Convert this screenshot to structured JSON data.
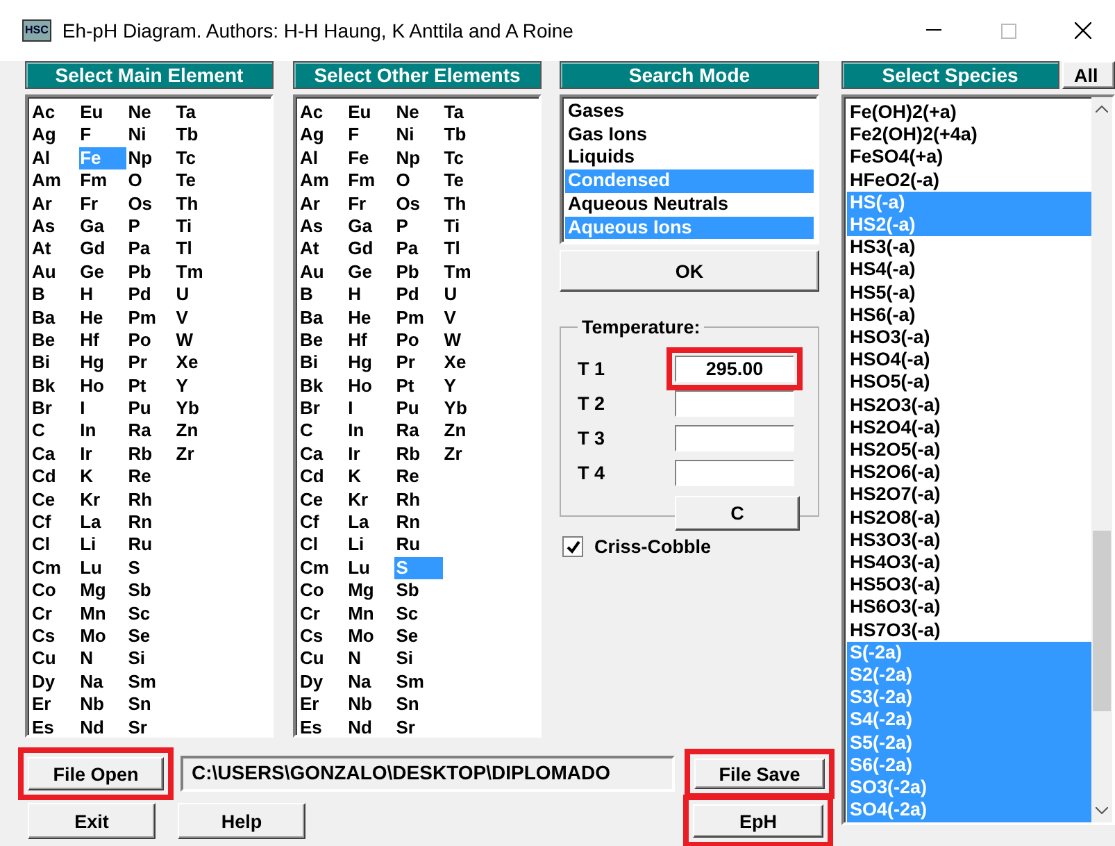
{
  "window": {
    "icon_text": "HSC",
    "title": "Eh-pH Diagram. Authors: H-H Haung, K Anttila and A Roine"
  },
  "main_element": {
    "header": "Select Main Element",
    "items": [
      {
        "label": "Ac",
        "selected": false
      },
      {
        "label": "Ag",
        "selected": false
      },
      {
        "label": "Al",
        "selected": false
      },
      {
        "label": "Am",
        "selected": false
      },
      {
        "label": "Ar",
        "selected": false
      },
      {
        "label": "As",
        "selected": false
      },
      {
        "label": "At",
        "selected": false
      },
      {
        "label": "Au",
        "selected": false
      },
      {
        "label": "B",
        "selected": false
      },
      {
        "label": "Ba",
        "selected": false
      },
      {
        "label": "Be",
        "selected": false
      },
      {
        "label": "Bi",
        "selected": false
      },
      {
        "label": "Bk",
        "selected": false
      },
      {
        "label": "Br",
        "selected": false
      },
      {
        "label": "C",
        "selected": false
      },
      {
        "label": "Ca",
        "selected": false
      },
      {
        "label": "Cd",
        "selected": false
      },
      {
        "label": "Ce",
        "selected": false
      },
      {
        "label": "Cf",
        "selected": false
      },
      {
        "label": "Cl",
        "selected": false
      },
      {
        "label": "Cm",
        "selected": false
      },
      {
        "label": "Co",
        "selected": false
      },
      {
        "label": "Cr",
        "selected": false
      },
      {
        "label": "Cs",
        "selected": false
      },
      {
        "label": "Cu",
        "selected": false
      },
      {
        "label": "Dy",
        "selected": false
      },
      {
        "label": "Er",
        "selected": false
      },
      {
        "label": "Es",
        "selected": false
      },
      {
        "label": "Eu",
        "selected": false
      },
      {
        "label": "F",
        "selected": false
      },
      {
        "label": "Fe",
        "selected": true
      },
      {
        "label": "Fm",
        "selected": false
      },
      {
        "label": "Fr",
        "selected": false
      },
      {
        "label": "Ga",
        "selected": false
      },
      {
        "label": "Gd",
        "selected": false
      },
      {
        "label": "Ge",
        "selected": false
      },
      {
        "label": "H",
        "selected": false
      },
      {
        "label": "He",
        "selected": false
      },
      {
        "label": "Hf",
        "selected": false
      },
      {
        "label": "Hg",
        "selected": false
      },
      {
        "label": "Ho",
        "selected": false
      },
      {
        "label": "I",
        "selected": false
      },
      {
        "label": "In",
        "selected": false
      },
      {
        "label": "Ir",
        "selected": false
      },
      {
        "label": "K",
        "selected": false
      },
      {
        "label": "Kr",
        "selected": false
      },
      {
        "label": "La",
        "selected": false
      },
      {
        "label": "Li",
        "selected": false
      },
      {
        "label": "Lu",
        "selected": false
      },
      {
        "label": "Mg",
        "selected": false
      },
      {
        "label": "Mn",
        "selected": false
      },
      {
        "label": "Mo",
        "selected": false
      },
      {
        "label": "N",
        "selected": false
      },
      {
        "label": "Na",
        "selected": false
      },
      {
        "label": "Nb",
        "selected": false
      },
      {
        "label": "Nd",
        "selected": false
      },
      {
        "label": "Ne",
        "selected": false
      },
      {
        "label": "Ni",
        "selected": false
      },
      {
        "label": "Np",
        "selected": false
      },
      {
        "label": "O",
        "selected": false
      },
      {
        "label": "Os",
        "selected": false
      },
      {
        "label": "P",
        "selected": false
      },
      {
        "label": "Pa",
        "selected": false
      },
      {
        "label": "Pb",
        "selected": false
      },
      {
        "label": "Pd",
        "selected": false
      },
      {
        "label": "Pm",
        "selected": false
      },
      {
        "label": "Po",
        "selected": false
      },
      {
        "label": "Pr",
        "selected": false
      },
      {
        "label": "Pt",
        "selected": false
      },
      {
        "label": "Pu",
        "selected": false
      },
      {
        "label": "Ra",
        "selected": false
      },
      {
        "label": "Rb",
        "selected": false
      },
      {
        "label": "Re",
        "selected": false
      },
      {
        "label": "Rh",
        "selected": false
      },
      {
        "label": "Rn",
        "selected": false
      },
      {
        "label": "Ru",
        "selected": false
      },
      {
        "label": "S",
        "selected": false
      },
      {
        "label": "Sb",
        "selected": false
      },
      {
        "label": "Sc",
        "selected": false
      },
      {
        "label": "Se",
        "selected": false
      },
      {
        "label": "Si",
        "selected": false
      },
      {
        "label": "Sm",
        "selected": false
      },
      {
        "label": "Sn",
        "selected": false
      },
      {
        "label": "Sr",
        "selected": false
      },
      {
        "label": "Ta",
        "selected": false
      },
      {
        "label": "Tb",
        "selected": false
      },
      {
        "label": "Tc",
        "selected": false
      },
      {
        "label": "Te",
        "selected": false
      },
      {
        "label": "Th",
        "selected": false
      },
      {
        "label": "Ti",
        "selected": false
      },
      {
        "label": "Tl",
        "selected": false
      },
      {
        "label": "Tm",
        "selected": false
      },
      {
        "label": "U",
        "selected": false
      },
      {
        "label": "V",
        "selected": false
      },
      {
        "label": "W",
        "selected": false
      },
      {
        "label": "Xe",
        "selected": false
      },
      {
        "label": "Y",
        "selected": false
      },
      {
        "label": "Yb",
        "selected": false
      },
      {
        "label": "Zn",
        "selected": false
      },
      {
        "label": "Zr",
        "selected": false
      }
    ]
  },
  "other_elements": {
    "header": "Select Other Elements",
    "items": [
      {
        "label": "Ac",
        "selected": false
      },
      {
        "label": "Ag",
        "selected": false
      },
      {
        "label": "Al",
        "selected": false
      },
      {
        "label": "Am",
        "selected": false
      },
      {
        "label": "Ar",
        "selected": false
      },
      {
        "label": "As",
        "selected": false
      },
      {
        "label": "At",
        "selected": false
      },
      {
        "label": "Au",
        "selected": false
      },
      {
        "label": "B",
        "selected": false
      },
      {
        "label": "Ba",
        "selected": false
      },
      {
        "label": "Be",
        "selected": false
      },
      {
        "label": "Bi",
        "selected": false
      },
      {
        "label": "Bk",
        "selected": false
      },
      {
        "label": "Br",
        "selected": false
      },
      {
        "label": "C",
        "selected": false
      },
      {
        "label": "Ca",
        "selected": false
      },
      {
        "label": "Cd",
        "selected": false
      },
      {
        "label": "Ce",
        "selected": false
      },
      {
        "label": "Cf",
        "selected": false
      },
      {
        "label": "Cl",
        "selected": false
      },
      {
        "label": "Cm",
        "selected": false
      },
      {
        "label": "Co",
        "selected": false
      },
      {
        "label": "Cr",
        "selected": false
      },
      {
        "label": "Cs",
        "selected": false
      },
      {
        "label": "Cu",
        "selected": false
      },
      {
        "label": "Dy",
        "selected": false
      },
      {
        "label": "Er",
        "selected": false
      },
      {
        "label": "Es",
        "selected": false
      },
      {
        "label": "Eu",
        "selected": false
      },
      {
        "label": "F",
        "selected": false
      },
      {
        "label": "Fe",
        "selected": false
      },
      {
        "label": "Fm",
        "selected": false
      },
      {
        "label": "Fr",
        "selected": false
      },
      {
        "label": "Ga",
        "selected": false
      },
      {
        "label": "Gd",
        "selected": false
      },
      {
        "label": "Ge",
        "selected": false
      },
      {
        "label": "H",
        "selected": false
      },
      {
        "label": "He",
        "selected": false
      },
      {
        "label": "Hf",
        "selected": false
      },
      {
        "label": "Hg",
        "selected": false
      },
      {
        "label": "Ho",
        "selected": false
      },
      {
        "label": "I",
        "selected": false
      },
      {
        "label": "In",
        "selected": false
      },
      {
        "label": "Ir",
        "selected": false
      },
      {
        "label": "K",
        "selected": false
      },
      {
        "label": "Kr",
        "selected": false
      },
      {
        "label": "La",
        "selected": false
      },
      {
        "label": "Li",
        "selected": false
      },
      {
        "label": "Lu",
        "selected": false
      },
      {
        "label": "Mg",
        "selected": false
      },
      {
        "label": "Mn",
        "selected": false
      },
      {
        "label": "Mo",
        "selected": false
      },
      {
        "label": "N",
        "selected": false
      },
      {
        "label": "Na",
        "selected": false
      },
      {
        "label": "Nb",
        "selected": false
      },
      {
        "label": "Nd",
        "selected": false
      },
      {
        "label": "Ne",
        "selected": false
      },
      {
        "label": "Ni",
        "selected": false
      },
      {
        "label": "Np",
        "selected": false
      },
      {
        "label": "O",
        "selected": false
      },
      {
        "label": "Os",
        "selected": false
      },
      {
        "label": "P",
        "selected": false
      },
      {
        "label": "Pa",
        "selected": false
      },
      {
        "label": "Pb",
        "selected": false
      },
      {
        "label": "Pd",
        "selected": false
      },
      {
        "label": "Pm",
        "selected": false
      },
      {
        "label": "Po",
        "selected": false
      },
      {
        "label": "Pr",
        "selected": false
      },
      {
        "label": "Pt",
        "selected": false
      },
      {
        "label": "Pu",
        "selected": false
      },
      {
        "label": "Ra",
        "selected": false
      },
      {
        "label": "Rb",
        "selected": false
      },
      {
        "label": "Re",
        "selected": false
      },
      {
        "label": "Rh",
        "selected": false
      },
      {
        "label": "Rn",
        "selected": false
      },
      {
        "label": "Ru",
        "selected": false
      },
      {
        "label": "S",
        "selected": true
      },
      {
        "label": "Sb",
        "selected": false
      },
      {
        "label": "Sc",
        "selected": false
      },
      {
        "label": "Se",
        "selected": false
      },
      {
        "label": "Si",
        "selected": false
      },
      {
        "label": "Sm",
        "selected": false
      },
      {
        "label": "Sn",
        "selected": false
      },
      {
        "label": "Sr",
        "selected": false
      },
      {
        "label": "Ta",
        "selected": false
      },
      {
        "label": "Tb",
        "selected": false
      },
      {
        "label": "Tc",
        "selected": false
      },
      {
        "label": "Te",
        "selected": false
      },
      {
        "label": "Th",
        "selected": false
      },
      {
        "label": "Ti",
        "selected": false
      },
      {
        "label": "Tl",
        "selected": false
      },
      {
        "label": "Tm",
        "selected": false
      },
      {
        "label": "U",
        "selected": false
      },
      {
        "label": "V",
        "selected": false
      },
      {
        "label": "W",
        "selected": false
      },
      {
        "label": "Xe",
        "selected": false
      },
      {
        "label": "Y",
        "selected": false
      },
      {
        "label": "Yb",
        "selected": false
      },
      {
        "label": "Zn",
        "selected": false
      },
      {
        "label": "Zr",
        "selected": false
      }
    ]
  },
  "search_mode": {
    "header": "Search Mode",
    "items": [
      {
        "label": "Gases",
        "selected": false
      },
      {
        "label": "Gas Ions",
        "selected": false
      },
      {
        "label": "Liquids",
        "selected": false
      },
      {
        "label": "Condensed",
        "selected": true
      },
      {
        "label": "Aqueous Neutrals",
        "selected": false
      },
      {
        "label": "Aqueous Ions",
        "selected": true
      }
    ],
    "ok_button": "OK"
  },
  "temperature": {
    "legend": "Temperature:",
    "fields": [
      {
        "label": "T 1",
        "value": "295.00",
        "highlighted": true
      },
      {
        "label": "T 2",
        "highlighted": false
      },
      {
        "label": "T 3",
        "highlighted": false
      },
      {
        "label": "T 4",
        "highlighted": false
      }
    ],
    "clear_button": "C"
  },
  "criss_cobble": {
    "label": "Criss-Cobble",
    "checked": true
  },
  "species": {
    "header": "Select Species",
    "all_button": "All",
    "items": [
      {
        "label": "Fe(OH)2(+a)",
        "selected": false
      },
      {
        "label": "Fe2(OH)2(+4a)",
        "selected": false
      },
      {
        "label": "FeSO4(+a)",
        "selected": false
      },
      {
        "label": "HFeO2(-a)",
        "selected": false
      },
      {
        "label": "HS(-a)",
        "selected": true
      },
      {
        "label": "HS2(-a)",
        "selected": true
      },
      {
        "label": "HS3(-a)",
        "selected": false
      },
      {
        "label": "HS4(-a)",
        "selected": false
      },
      {
        "label": "HS5(-a)",
        "selected": false
      },
      {
        "label": "HS6(-a)",
        "selected": false
      },
      {
        "label": "HSO3(-a)",
        "selected": false
      },
      {
        "label": "HSO4(-a)",
        "selected": false
      },
      {
        "label": "HSO5(-a)",
        "selected": false
      },
      {
        "label": "HS2O3(-a)",
        "selected": false
      },
      {
        "label": "HS2O4(-a)",
        "selected": false
      },
      {
        "label": "HS2O5(-a)",
        "selected": false
      },
      {
        "label": "HS2O6(-a)",
        "selected": false
      },
      {
        "label": "HS2O7(-a)",
        "selected": false
      },
      {
        "label": "HS2O8(-a)",
        "selected": false
      },
      {
        "label": "HS3O3(-a)",
        "selected": false
      },
      {
        "label": "HS4O3(-a)",
        "selected": false
      },
      {
        "label": "HS5O3(-a)",
        "selected": false
      },
      {
        "label": "HS6O3(-a)",
        "selected": false
      },
      {
        "label": "HS7O3(-a)",
        "selected": false
      },
      {
        "label": "S(-2a)",
        "selected": true
      },
      {
        "label": "S2(-2a)",
        "selected": true
      },
      {
        "label": "S3(-2a)",
        "selected": true
      },
      {
        "label": "S4(-2a)",
        "selected": true
      },
      {
        "label": "S5(-2a)",
        "selected": true
      },
      {
        "label": "S6(-2a)",
        "selected": true
      },
      {
        "label": "SO3(-2a)",
        "selected": true
      },
      {
        "label": "SO4(-2a)",
        "selected": true
      }
    ]
  },
  "file_open": {
    "label": "File Open",
    "highlighted": true
  },
  "file_path": "C:\\USERS\\GONZALO\\DESKTOP\\DIPLOMADO",
  "file_save": {
    "label": "File Save",
    "highlighted": true
  },
  "exit": {
    "label": "Exit"
  },
  "help": {
    "label": "Help"
  },
  "eph": {
    "label": "EpH",
    "highlighted": true
  }
}
